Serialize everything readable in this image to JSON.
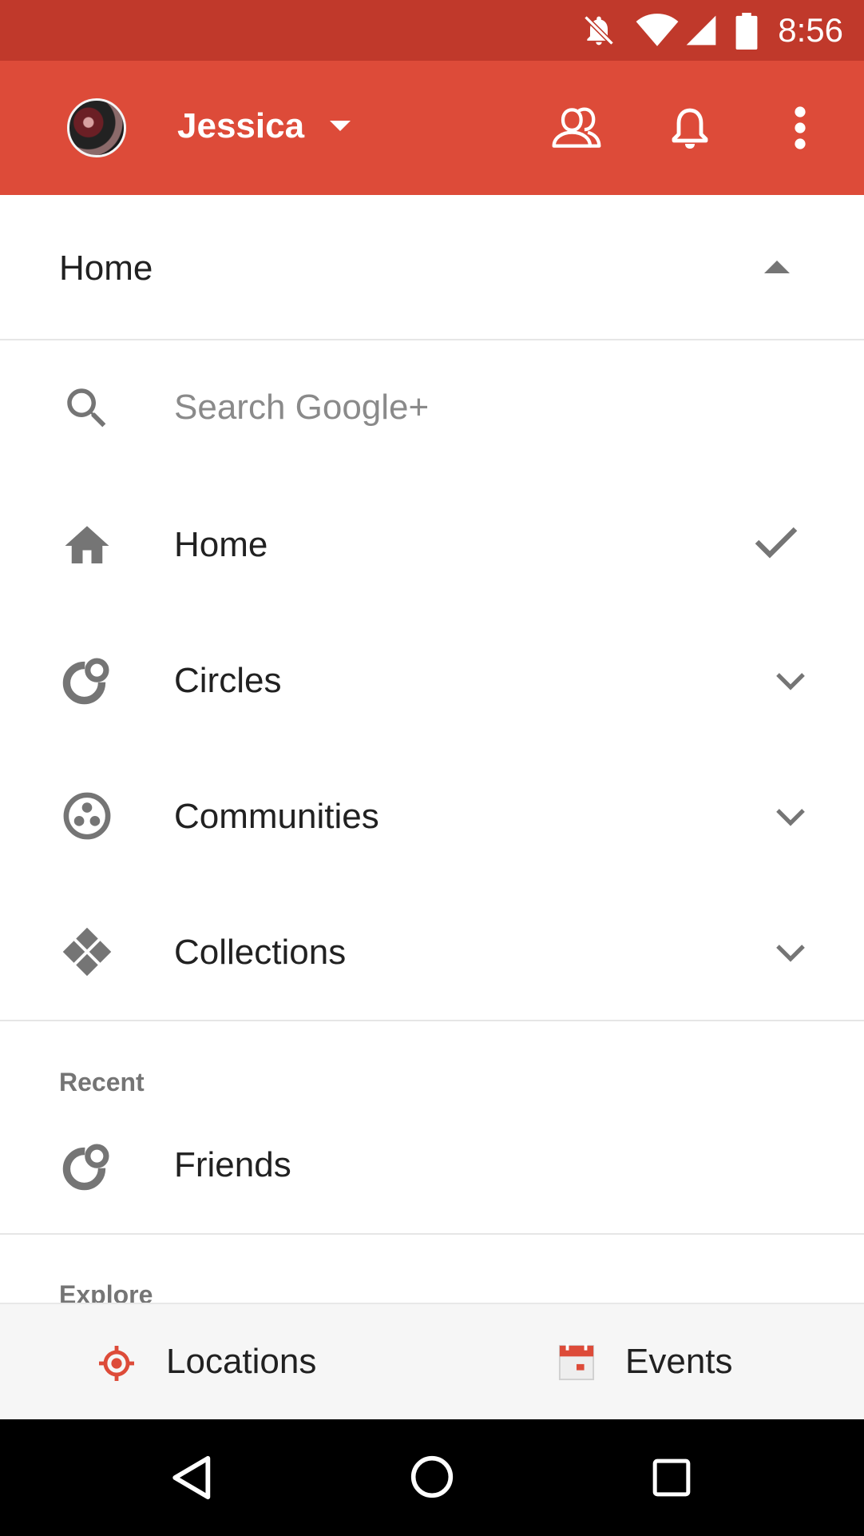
{
  "status_bar": {
    "time": "8:56",
    "icons": [
      "notifications-off-icon",
      "wifi-icon",
      "cellular-signal-icon",
      "battery-icon"
    ],
    "background": "#c0392b"
  },
  "app_bar": {
    "account_name": "Jessica",
    "background": "#dd4b39",
    "icons": [
      "account-dropdown-icon",
      "people-icon",
      "notifications-bell-icon",
      "more-vert-icon"
    ]
  },
  "home_selector": {
    "label": "Home"
  },
  "menu": {
    "search_placeholder": "Search Google+",
    "items": [
      {
        "label": "Home",
        "icon": "home-icon",
        "trailing": "checkmark-icon",
        "selected": true
      },
      {
        "label": "Circles",
        "icon": "circles-icon",
        "trailing": "chevron-down-icon"
      },
      {
        "label": "Communities",
        "icon": "communities-icon",
        "trailing": "chevron-down-icon"
      },
      {
        "label": "Collections",
        "icon": "collections-icon",
        "trailing": "chevron-down-icon"
      }
    ]
  },
  "recent": {
    "header": "Recent",
    "items": [
      {
        "label": "Friends",
        "icon": "circles-icon"
      }
    ]
  },
  "explore": {
    "header": "Explore"
  },
  "bottom_tray": {
    "locations_label": "Locations",
    "events_label": "Events",
    "accent": "#dd4b39"
  },
  "nav_bar": {
    "buttons": [
      "back-icon",
      "home-circle-icon",
      "recents-icon"
    ]
  }
}
